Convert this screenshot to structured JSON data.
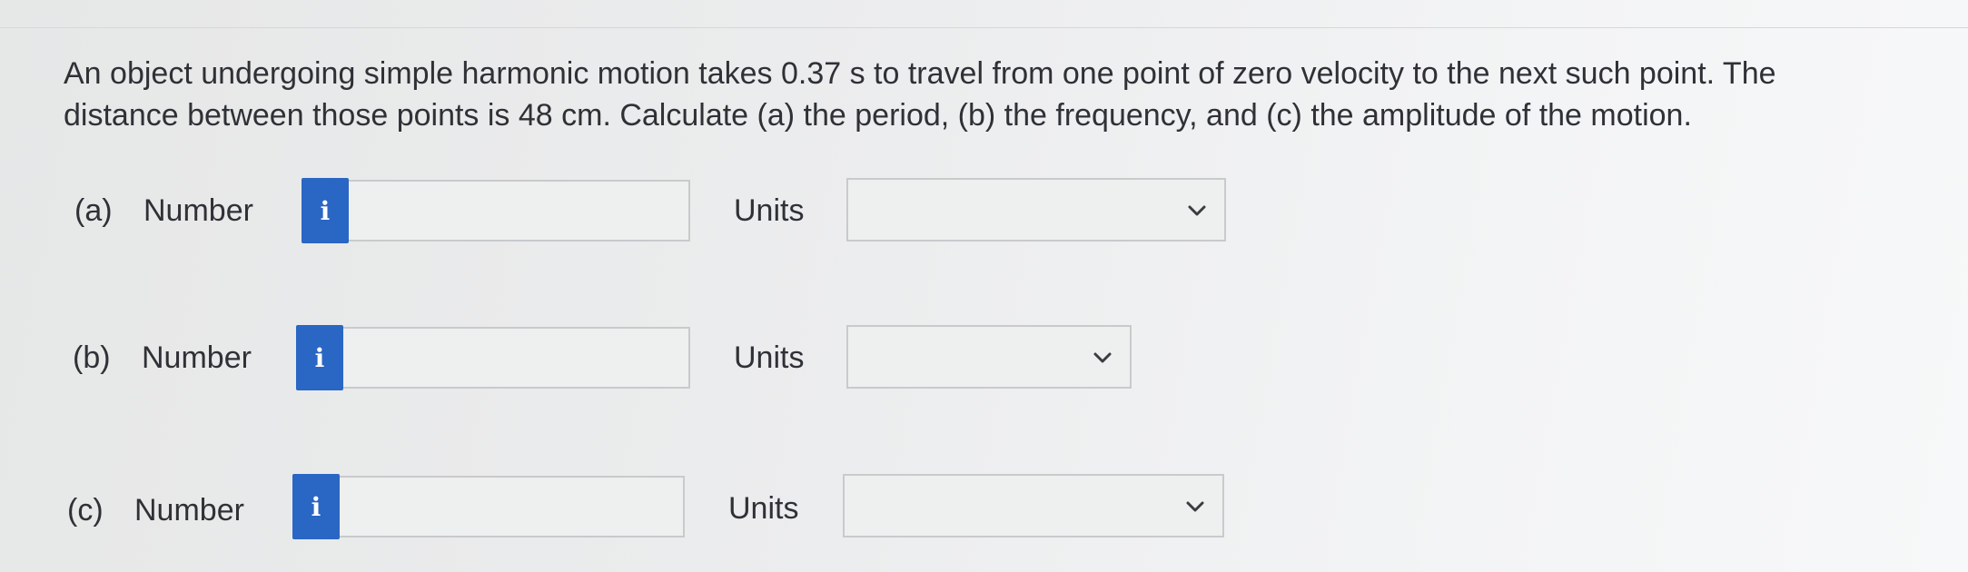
{
  "question": {
    "text": "An object undergoing simple harmonic motion takes 0.37 s to travel from one point of zero velocity to the next such point. The distance between those points is 48 cm. Calculate (a) the period, (b) the frequency, and (c) the amplitude of the motion."
  },
  "parts": [
    {
      "label": "(a)",
      "number_label": "Number",
      "info_glyph": "i",
      "number_value": "",
      "units_label": "Units",
      "units_selected": "",
      "chevron": "chevron-down-icon"
    },
    {
      "label": "(b)",
      "number_label": "Number",
      "info_glyph": "i",
      "number_value": "",
      "units_label": "Units",
      "units_selected": "",
      "chevron": "chevron-down-icon"
    },
    {
      "label": "(c)",
      "number_label": "Number",
      "info_glyph": "i",
      "number_value": "",
      "units_label": "Units",
      "units_selected": "",
      "chevron": "chevron-down-icon"
    }
  ],
  "colors": {
    "info_button": "#2a66c4",
    "text": "#2f3136",
    "field_border": "#c8cacc"
  }
}
